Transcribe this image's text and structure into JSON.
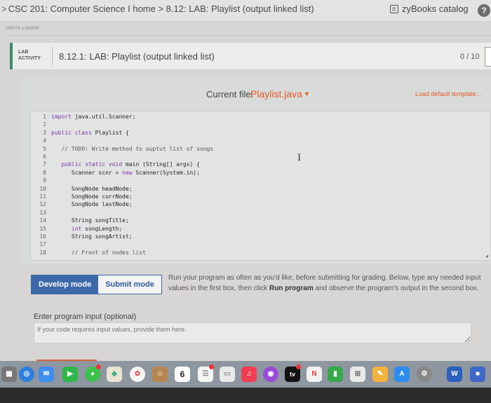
{
  "breadcrumb": "CSC 201: Computer Science I home > 8.12: LAB: Playlist (output linked list)",
  "catalog_label": "zyBooks catalog",
  "help_label": "?",
  "id_line": "295574 1388808",
  "lab": {
    "tag_line1": "LAB",
    "tag_line2": "ACTIVITY",
    "title": "8.12.1: LAB: Playlist (output linked list)",
    "score": "0 / 10"
  },
  "editor": {
    "current_file_label": "Current file:",
    "current_file": "Playlist.java",
    "load_default": "Load default template...",
    "lines": [
      {
        "n": "1",
        "text": "import java.util.Scanner;"
      },
      {
        "n": "2",
        "text": ""
      },
      {
        "n": "3",
        "text": "public class Playlist {"
      },
      {
        "n": "4",
        "text": ""
      },
      {
        "n": "5",
        "text": "   // TODO: Write method to ouptut list of songs"
      },
      {
        "n": "6",
        "text": ""
      },
      {
        "n": "7",
        "text": "   public static void main (String[] args) {"
      },
      {
        "n": "8",
        "text": "      Scanner scnr = new Scanner(System.in);"
      },
      {
        "n": "9",
        "text": ""
      },
      {
        "n": "10",
        "text": "      SongNode headNode;"
      },
      {
        "n": "11",
        "text": "      SongNode currNode;"
      },
      {
        "n": "12",
        "text": "      SongNode lastNode;"
      },
      {
        "n": "13",
        "text": ""
      },
      {
        "n": "14",
        "text": "      String songTitle;"
      },
      {
        "n": "15",
        "text": "      int songLength;"
      },
      {
        "n": "16",
        "text": "      String songArtist;"
      },
      {
        "n": "17",
        "text": ""
      },
      {
        "n": "18",
        "text": "      // Front of nodes list"
      }
    ]
  },
  "modes": {
    "develop": "Develop mode",
    "submit": "Submit mode"
  },
  "run_help_pre": "Run your program as often as you'd like, before submitting for grading. Below, type any needed input values in the first box, then click ",
  "run_help_bold": "Run program",
  "run_help_post": " and observe the program's output in the second box.",
  "input": {
    "label": "Enter program input (optional)",
    "placeholder": "If your code requires input values, provide them here."
  },
  "dock": {
    "calendar_day": "6",
    "tv_label": "tv",
    "word_label": "W"
  },
  "colors": {
    "accent": "#e05a25",
    "mode_active": "#3e69a8",
    "lab_bar": "#3a8d6b"
  }
}
